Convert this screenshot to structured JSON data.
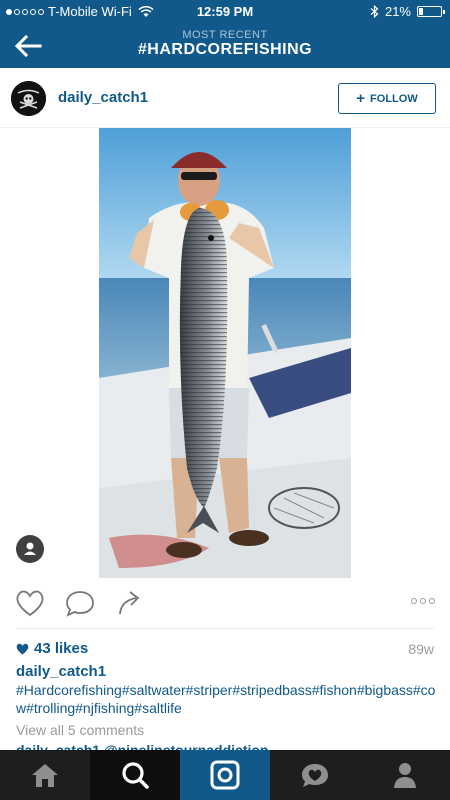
{
  "status_bar": {
    "carrier": "T-Mobile Wi-Fi",
    "time": "12:59 PM",
    "battery": "21%",
    "battery_level": 0.21
  },
  "header": {
    "subtitle": "MOST RECENT",
    "title": "#HARDCOREFISHING"
  },
  "post": {
    "username": "daily_catch1",
    "follow_label": "FOLLOW",
    "likes": "43 likes",
    "time_ago": "89w",
    "caption_user": "daily_catch1",
    "caption_text": "#Hardcorefishing#saltwater#striper#stripedbass#fishon#bigbass#cow#trolling#njfishing#saltlife",
    "view_comments": "View all 5 comments",
    "next_comment_partial": "daily_catch1 @ninelinetournaddiction"
  },
  "colors": {
    "brand": "#11598a",
    "tabbar": "#1e1e1e",
    "muted": "#9a9a9a"
  },
  "tabs": [
    {
      "icon": "home-icon"
    },
    {
      "icon": "search-icon"
    },
    {
      "icon": "camera-icon"
    },
    {
      "icon": "activity-icon"
    },
    {
      "icon": "profile-icon"
    }
  ]
}
